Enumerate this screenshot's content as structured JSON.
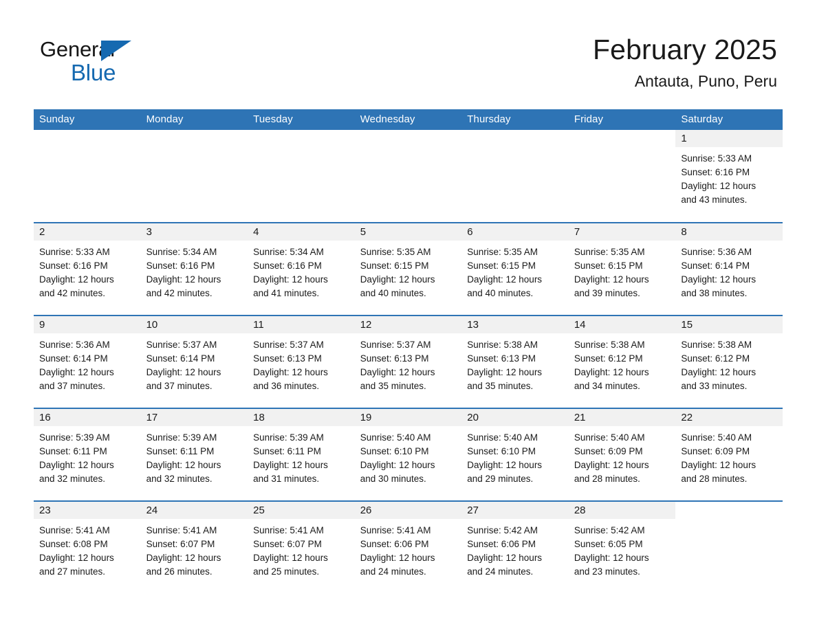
{
  "brand": {
    "name_part1": "General",
    "name_part2": "Blue",
    "triangle_color": "#1569b0",
    "text_color": "#161616"
  },
  "header": {
    "title": "February 2025",
    "location": "Antauta, Puno, Peru"
  },
  "theme": {
    "header_bar": "#2E74B5",
    "day_number_strip": "#F1F1F1",
    "row_separator": "#2E74B5",
    "text": "#1A1A1A",
    "background": "#FFFFFF"
  },
  "calendar": {
    "weekday_headers": [
      "Sunday",
      "Monday",
      "Tuesday",
      "Wednesday",
      "Thursday",
      "Friday",
      "Saturday"
    ],
    "weeks": [
      [
        {
          "empty": true
        },
        {
          "empty": true
        },
        {
          "empty": true
        },
        {
          "empty": true
        },
        {
          "empty": true
        },
        {
          "empty": true
        },
        {
          "day": "1",
          "sunrise": "Sunrise: 5:33 AM",
          "sunset": "Sunset: 6:16 PM",
          "daylight_line1": "Daylight: 12 hours",
          "daylight_line2": "and 43 minutes."
        }
      ],
      [
        {
          "day": "2",
          "sunrise": "Sunrise: 5:33 AM",
          "sunset": "Sunset: 6:16 PM",
          "daylight_line1": "Daylight: 12 hours",
          "daylight_line2": "and 42 minutes."
        },
        {
          "day": "3",
          "sunrise": "Sunrise: 5:34 AM",
          "sunset": "Sunset: 6:16 PM",
          "daylight_line1": "Daylight: 12 hours",
          "daylight_line2": "and 42 minutes."
        },
        {
          "day": "4",
          "sunrise": "Sunrise: 5:34 AM",
          "sunset": "Sunset: 6:16 PM",
          "daylight_line1": "Daylight: 12 hours",
          "daylight_line2": "and 41 minutes."
        },
        {
          "day": "5",
          "sunrise": "Sunrise: 5:35 AM",
          "sunset": "Sunset: 6:15 PM",
          "daylight_line1": "Daylight: 12 hours",
          "daylight_line2": "and 40 minutes."
        },
        {
          "day": "6",
          "sunrise": "Sunrise: 5:35 AM",
          "sunset": "Sunset: 6:15 PM",
          "daylight_line1": "Daylight: 12 hours",
          "daylight_line2": "and 40 minutes."
        },
        {
          "day": "7",
          "sunrise": "Sunrise: 5:35 AM",
          "sunset": "Sunset: 6:15 PM",
          "daylight_line1": "Daylight: 12 hours",
          "daylight_line2": "and 39 minutes."
        },
        {
          "day": "8",
          "sunrise": "Sunrise: 5:36 AM",
          "sunset": "Sunset: 6:14 PM",
          "daylight_line1": "Daylight: 12 hours",
          "daylight_line2": "and 38 minutes."
        }
      ],
      [
        {
          "day": "9",
          "sunrise": "Sunrise: 5:36 AM",
          "sunset": "Sunset: 6:14 PM",
          "daylight_line1": "Daylight: 12 hours",
          "daylight_line2": "and 37 minutes."
        },
        {
          "day": "10",
          "sunrise": "Sunrise: 5:37 AM",
          "sunset": "Sunset: 6:14 PM",
          "daylight_line1": "Daylight: 12 hours",
          "daylight_line2": "and 37 minutes."
        },
        {
          "day": "11",
          "sunrise": "Sunrise: 5:37 AM",
          "sunset": "Sunset: 6:13 PM",
          "daylight_line1": "Daylight: 12 hours",
          "daylight_line2": "and 36 minutes."
        },
        {
          "day": "12",
          "sunrise": "Sunrise: 5:37 AM",
          "sunset": "Sunset: 6:13 PM",
          "daylight_line1": "Daylight: 12 hours",
          "daylight_line2": "and 35 minutes."
        },
        {
          "day": "13",
          "sunrise": "Sunrise: 5:38 AM",
          "sunset": "Sunset: 6:13 PM",
          "daylight_line1": "Daylight: 12 hours",
          "daylight_line2": "and 35 minutes."
        },
        {
          "day": "14",
          "sunrise": "Sunrise: 5:38 AM",
          "sunset": "Sunset: 6:12 PM",
          "daylight_line1": "Daylight: 12 hours",
          "daylight_line2": "and 34 minutes."
        },
        {
          "day": "15",
          "sunrise": "Sunrise: 5:38 AM",
          "sunset": "Sunset: 6:12 PM",
          "daylight_line1": "Daylight: 12 hours",
          "daylight_line2": "and 33 minutes."
        }
      ],
      [
        {
          "day": "16",
          "sunrise": "Sunrise: 5:39 AM",
          "sunset": "Sunset: 6:11 PM",
          "daylight_line1": "Daylight: 12 hours",
          "daylight_line2": "and 32 minutes."
        },
        {
          "day": "17",
          "sunrise": "Sunrise: 5:39 AM",
          "sunset": "Sunset: 6:11 PM",
          "daylight_line1": "Daylight: 12 hours",
          "daylight_line2": "and 32 minutes."
        },
        {
          "day": "18",
          "sunrise": "Sunrise: 5:39 AM",
          "sunset": "Sunset: 6:11 PM",
          "daylight_line1": "Daylight: 12 hours",
          "daylight_line2": "and 31 minutes."
        },
        {
          "day": "19",
          "sunrise": "Sunrise: 5:40 AM",
          "sunset": "Sunset: 6:10 PM",
          "daylight_line1": "Daylight: 12 hours",
          "daylight_line2": "and 30 minutes."
        },
        {
          "day": "20",
          "sunrise": "Sunrise: 5:40 AM",
          "sunset": "Sunset: 6:10 PM",
          "daylight_line1": "Daylight: 12 hours",
          "daylight_line2": "and 29 minutes."
        },
        {
          "day": "21",
          "sunrise": "Sunrise: 5:40 AM",
          "sunset": "Sunset: 6:09 PM",
          "daylight_line1": "Daylight: 12 hours",
          "daylight_line2": "and 28 minutes."
        },
        {
          "day": "22",
          "sunrise": "Sunrise: 5:40 AM",
          "sunset": "Sunset: 6:09 PM",
          "daylight_line1": "Daylight: 12 hours",
          "daylight_line2": "and 28 minutes."
        }
      ],
      [
        {
          "day": "23",
          "sunrise": "Sunrise: 5:41 AM",
          "sunset": "Sunset: 6:08 PM",
          "daylight_line1": "Daylight: 12 hours",
          "daylight_line2": "and 27 minutes."
        },
        {
          "day": "24",
          "sunrise": "Sunrise: 5:41 AM",
          "sunset": "Sunset: 6:07 PM",
          "daylight_line1": "Daylight: 12 hours",
          "daylight_line2": "and 26 minutes."
        },
        {
          "day": "25",
          "sunrise": "Sunrise: 5:41 AM",
          "sunset": "Sunset: 6:07 PM",
          "daylight_line1": "Daylight: 12 hours",
          "daylight_line2": "and 25 minutes."
        },
        {
          "day": "26",
          "sunrise": "Sunrise: 5:41 AM",
          "sunset": "Sunset: 6:06 PM",
          "daylight_line1": "Daylight: 12 hours",
          "daylight_line2": "and 24 minutes."
        },
        {
          "day": "27",
          "sunrise": "Sunrise: 5:42 AM",
          "sunset": "Sunset: 6:06 PM",
          "daylight_line1": "Daylight: 12 hours",
          "daylight_line2": "and 24 minutes."
        },
        {
          "day": "28",
          "sunrise": "Sunrise: 5:42 AM",
          "sunset": "Sunset: 6:05 PM",
          "daylight_line1": "Daylight: 12 hours",
          "daylight_line2": "and 23 minutes."
        },
        {
          "empty": true
        }
      ]
    ]
  }
}
